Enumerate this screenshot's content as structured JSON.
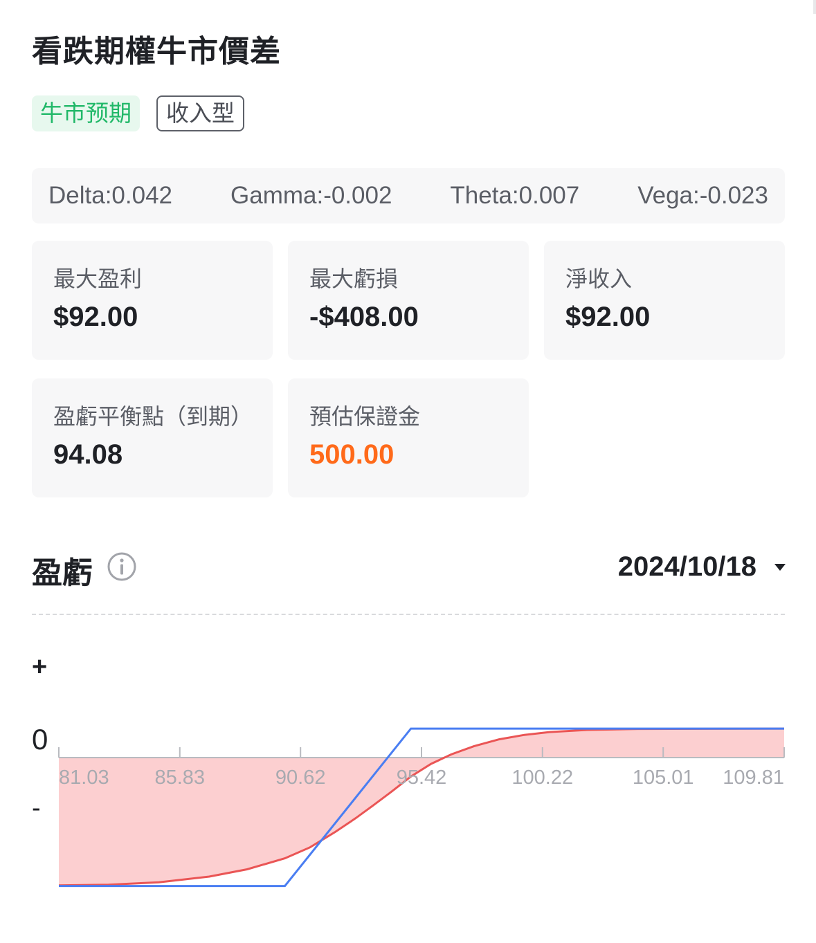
{
  "title": "看跌期權牛市價差",
  "tags": [
    {
      "label": "牛市预期",
      "style": "green"
    },
    {
      "label": "收入型",
      "style": "outline"
    }
  ],
  "greeks": [
    {
      "label": "Delta:0.042"
    },
    {
      "label": "Gamma:-0.002"
    },
    {
      "label": "Theta:0.007"
    },
    {
      "label": "Vega:-0.023"
    }
  ],
  "metrics": [
    {
      "label": "最大盈利",
      "value": "$92.00"
    },
    {
      "label": "最大虧損",
      "value": "-$408.00"
    },
    {
      "label": "淨收入",
      "value": "$92.00"
    },
    {
      "label": "盈虧平衡點（到期）",
      "value": "94.08"
    },
    {
      "label": "預估保證金",
      "value": "500.00"
    }
  ],
  "colors": {
    "accent_green": "#20b868",
    "accent_orange": "#ff6a1a",
    "expiry_line": "#4a7ef2",
    "current_line": "#ea5555",
    "current_fill": "#fccfd0"
  },
  "pnl": {
    "title": "盈虧",
    "info_icon": "info-circle-icon",
    "date": "2024/10/18",
    "date_icon": "caret-down-icon"
  },
  "chart_data": {
    "type": "line",
    "y_labels": {
      "plus": "+",
      "zero": "0",
      "minus": "-"
    },
    "x_ticks": [
      81.03,
      85.83,
      90.62,
      95.42,
      100.22,
      105.01,
      109.81
    ],
    "x_tick_labels": [
      "81.03",
      "85.83",
      "90.62",
      "95.42",
      "100.22",
      "105.01",
      "109.81"
    ],
    "xlim": [
      81.03,
      109.81
    ],
    "ylim": [
      -408,
      408
    ],
    "series": [
      {
        "role": "expiry",
        "x": [
          81.03,
          90.0,
          95.0,
          109.81
        ],
        "y": [
          -408,
          -408,
          92,
          92
        ]
      },
      {
        "role": "current",
        "x": [
          81.03,
          83.0,
          85.0,
          87.0,
          88.5,
          90.0,
          91.0,
          92.0,
          92.8,
          93.5,
          94.2,
          95.0,
          95.8,
          96.6,
          97.5,
          98.5,
          99.5,
          100.5,
          102.0,
          104.0,
          109.81
        ],
        "y": [
          -406,
          -404,
          -396,
          -378,
          -355,
          -320,
          -285,
          -236,
          -193,
          -152,
          -110,
          -60,
          -20,
          10,
          36,
          58,
          72,
          81,
          88,
          91,
          92
        ]
      }
    ]
  }
}
